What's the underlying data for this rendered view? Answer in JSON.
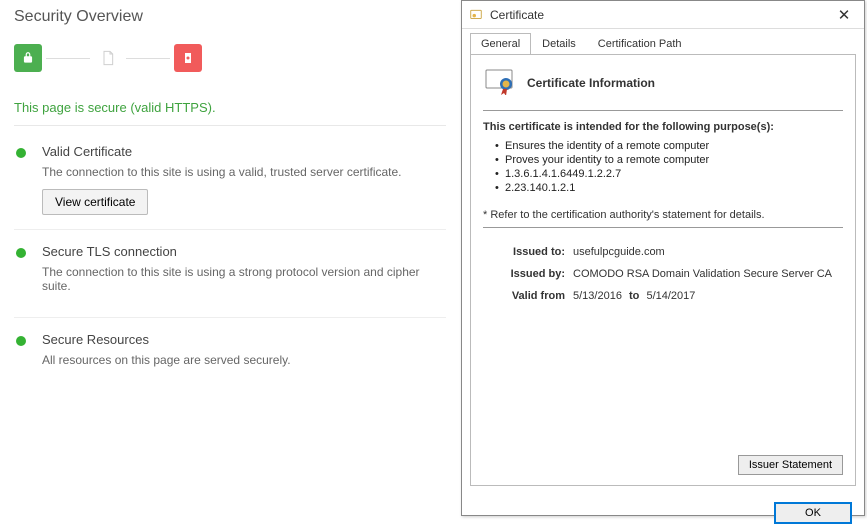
{
  "title": "Security Overview",
  "banner": "This page is secure (valid HTTPS).",
  "sections": {
    "cert": {
      "title": "Valid Certificate",
      "desc": "The connection to this site is using a valid, trusted server certificate.",
      "button": "View certificate"
    },
    "tls": {
      "title": "Secure TLS connection",
      "desc": "The connection to this site is using a strong protocol version and cipher suite."
    },
    "res": {
      "title": "Secure Resources",
      "desc": "All resources on this page are served securely."
    }
  },
  "dialog": {
    "title": "Certificate",
    "tabs": {
      "general": "General",
      "details": "Details",
      "path": "Certification Path"
    },
    "header": "Certificate Information",
    "purpose_heading": "This certificate is intended for the following purpose(s):",
    "purposes": [
      "Ensures the identity of a remote computer",
      "Proves your identity to a remote computer",
      "1.3.6.1.4.1.6449.1.2.2.7",
      "2.23.140.1.2.1"
    ],
    "refer": "* Refer to the certification authority's statement for details.",
    "issued_to_label": "Issued to:",
    "issued_to": "usefulpcguide.com",
    "issued_by_label": "Issued by:",
    "issued_by": "COMODO RSA Domain Validation Secure Server CA",
    "valid_label": "Valid from",
    "valid_from": "5/13/2016",
    "valid_to_label": "to",
    "valid_to": "5/14/2017",
    "issuer_button": "Issuer Statement",
    "ok": "OK"
  }
}
